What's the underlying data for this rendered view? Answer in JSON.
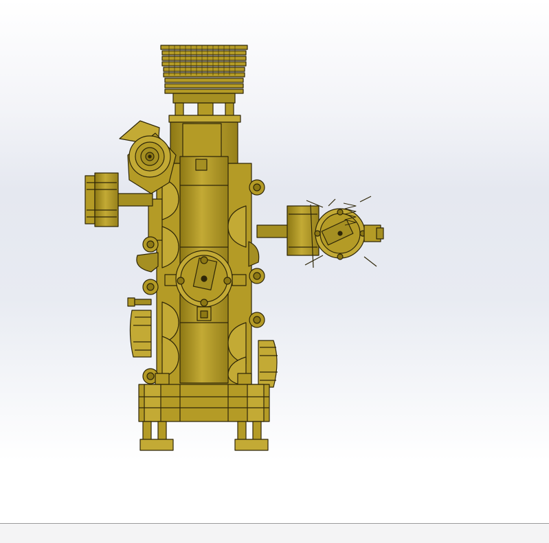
{
  "viewport": {
    "model": "engine-assembly",
    "view": "front",
    "colors": {
      "body": "#b49b26",
      "dark": "#8d7814",
      "light": "#cdb545",
      "edge": "#2e2608",
      "background_top": "#ffffff",
      "background_mid": "#e5e8f0"
    }
  },
  "status_bar": {}
}
